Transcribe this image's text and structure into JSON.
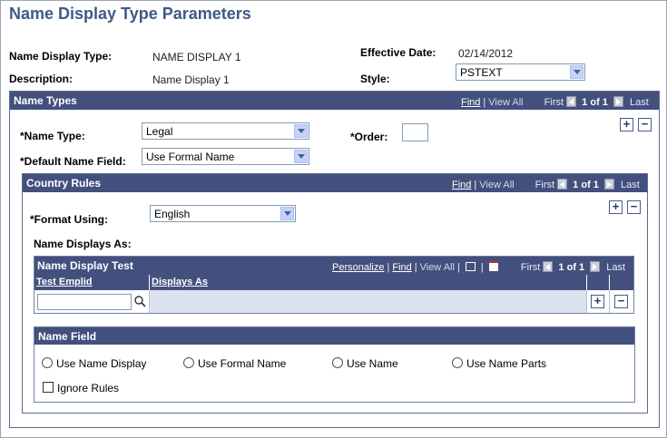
{
  "page": {
    "title": "Name Display Type Parameters"
  },
  "header": {
    "name_display_type_label": "Name Display Type:",
    "name_display_type_value": "NAME DISPLAY 1",
    "description_label": "Description:",
    "description_value": "Name Display 1",
    "effective_date_label": "Effective Date:",
    "effective_date_value": "02/14/2012",
    "style_label": "Style:",
    "style_value": "PSTEXT"
  },
  "name_types": {
    "title": "Name Types",
    "nav": {
      "find": "Find",
      "view_all": "View All",
      "first": "First",
      "count": "1 of 1",
      "last": "Last"
    },
    "name_type_label": "*Name Type:",
    "name_type_value": "Legal",
    "order_label": "*Order:",
    "order_value": "",
    "default_name_field_label": "*Default Name Field:",
    "default_name_field_value": "Use Formal Name",
    "add_symbol": "+",
    "remove_symbol": "−"
  },
  "country_rules": {
    "title": "Country Rules",
    "nav": {
      "find": "Find",
      "view_all": "View All",
      "first": "First",
      "count": "1 of 1",
      "last": "Last"
    },
    "format_using_label": "*Format Using:",
    "format_using_value": "English",
    "name_displays_as_label": "Name Displays As:",
    "add_symbol": "+",
    "remove_symbol": "−"
  },
  "name_display_test": {
    "title": "Name Display Test",
    "nav": {
      "personalize": "Personalize",
      "find": "Find",
      "view_all": "View All",
      "first": "First",
      "count": "1 of 1",
      "last": "Last"
    },
    "columns": [
      "Test Emplid",
      "Displays As"
    ],
    "test_emplid_value": "",
    "add_symbol": "+",
    "remove_symbol": "−"
  },
  "name_field": {
    "title": "Name Field",
    "options": [
      "Use Name Display",
      "Use Formal Name",
      "Use Name",
      "Use Name Parts"
    ],
    "ignore_rules_label": "Ignore Rules",
    "ignore_rules_checked": false
  }
}
